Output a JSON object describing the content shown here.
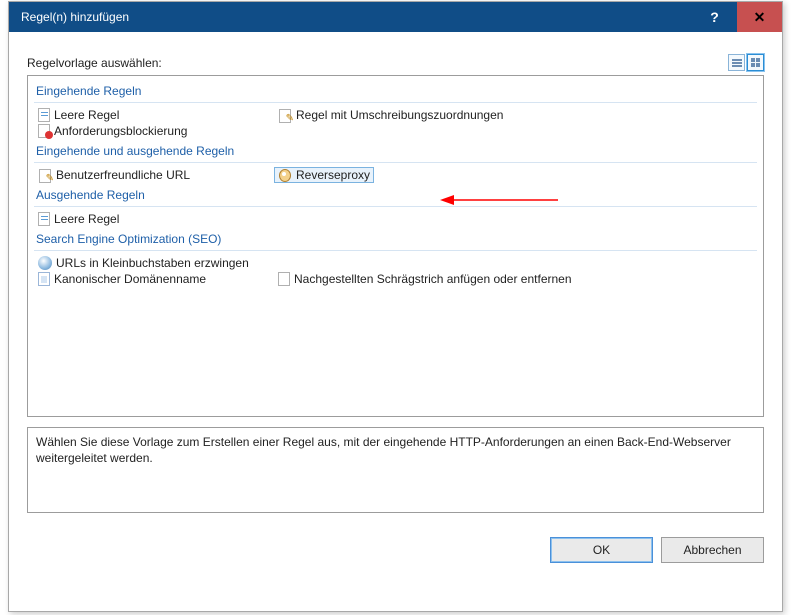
{
  "title": "Regel(n) hinzufügen",
  "label_select_template": "Regelvorlage auswählen:",
  "groups": {
    "inbound": {
      "header": "Eingehende Regeln",
      "empty_rule": "Leere Regel",
      "rewrite_map": "Regel mit Umschreibungszuordnungen",
      "block": "Anforderungsblockierung"
    },
    "both": {
      "header": "Eingehende und ausgehende Regeln",
      "friendly_url": "Benutzerfreundliche URL",
      "reverse_proxy": "Reverseproxy"
    },
    "outbound": {
      "header": "Ausgehende Regeln",
      "empty_rule": "Leere Regel"
    },
    "seo": {
      "header": "Search Engine Optimization (SEO)",
      "lowercase": "URLs in Kleinbuchstaben erzwingen",
      "canonical": "Kanonischer Domänenname",
      "slash": "Nachgestellten Schrägstrich anfügen oder entfernen"
    }
  },
  "description": "Wählen Sie diese Vorlage zum Erstellen einer Regel aus, mit der eingehende HTTP-Anforderungen an einen Back-End-Webserver weitergeleitet werden.",
  "buttons": {
    "ok": "OK",
    "cancel": "Abbrechen"
  }
}
